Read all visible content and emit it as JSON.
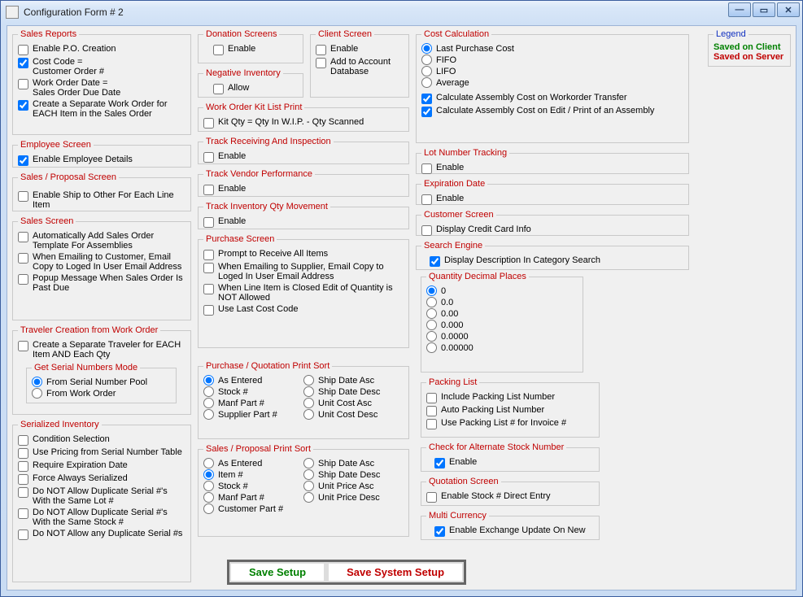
{
  "window": {
    "title": "Configuration Form # 2"
  },
  "legend": {
    "title": "Legend",
    "client": "Saved on Client",
    "server": "Saved on Server"
  },
  "salesReports": {
    "title": "Sales Reports",
    "enablePO": "Enable P.O.  Creation",
    "costCode": "Cost Code =\nCustomer Order #",
    "woDate": "Work Order Date =\nSales Order Due Date",
    "sepWO": "Create a Separate Work  Order for EACH  Item in the Sales Order"
  },
  "employee": {
    "title": "Employee Screen",
    "enable": "Enable Employee Details"
  },
  "salesProposal": {
    "title": "Sales  / Proposal Screen",
    "shipOther": "Enable Ship to Other For Each Line Item"
  },
  "salesScreen": {
    "title": "Sales Screen",
    "autoAdd": "Automatically Add Sales Order Template For Assemblies",
    "emailCopy": "When Emailing to Customer, Email Copy to Loged In User Email Address",
    "popup": "Popup Message When Sales Order Is Past Due"
  },
  "traveler": {
    "title": "Traveler Creation from Work Order",
    "sepTrav": "Create a Separate Traveler for EACH  Item AND Each Qty",
    "serialMode": {
      "title": "Get Serial Numbers Mode",
      "pool": "From Serial Number Pool",
      "wo": "From Work Order"
    }
  },
  "serialized": {
    "title": "Serialized Inventory",
    "cond": "Condition Selection",
    "pricing": "Use Pricing from Serial Number Table",
    "reqExp": "Require Expiration Date",
    "force": "Force Always Serialized",
    "dupLot": "Do NOT Allow Duplicate Serial #'s With the Same Lot #",
    "dupStock": "Do NOT Allow Duplicate Serial #'s With the Same Stock #",
    "dupAny": "Do NOT Allow any Duplicate Serial #s"
  },
  "donation": {
    "title": "Donation Screens",
    "enable": "Enable"
  },
  "negInv": {
    "title": "Negative Inventory",
    "allow": "Allow"
  },
  "clientScreen": {
    "title": "Client Screen",
    "enable": "Enable",
    "addDb": "Add to Account Database"
  },
  "woKit": {
    "title": "Work Order Kit List Print",
    "opt": "Kit Qty = Qty In W.I.P. - Qty Scanned"
  },
  "trackRecv": {
    "title": "Track Receiving And Inspection",
    "enable": "Enable"
  },
  "trackVendor": {
    "title": "Track Vendor Performance",
    "enable": "Enable"
  },
  "trackInvQty": {
    "title": "Track Inventory Qty Movement",
    "enable": "Enable"
  },
  "purchase": {
    "title": "Purchase Screen",
    "prompt": "Prompt to Receive All Items",
    "emailCopy": "When Emailing to Supplier, Email Copy to Loged In User Email Address",
    "closed": "When Line Item is Closed Edit of Quantity is NOT Allowed",
    "lastCost": "Use Last Cost Code"
  },
  "purchaseSort": {
    "title": "Purchase / Quotation Print Sort",
    "asEntered": "As Entered",
    "stock": "Stock #",
    "manf": "Manf Part #",
    "supplier": "Supplier Part #",
    "shipAsc": "Ship Date Asc",
    "shipDesc": "Ship Date Desc",
    "unitAsc": "Unit Cost Asc",
    "unitDesc": "Unit Cost Desc"
  },
  "salesSort": {
    "title": "Sales / Proposal Print Sort",
    "asEntered": "As Entered",
    "item": "Item #",
    "stock": "Stock #",
    "manf": "Manf Part #",
    "cust": "Customer Part #",
    "shipAsc": "Ship Date Asc",
    "shipDesc": "Ship Date Desc",
    "unitAsc": "Unit Price Asc",
    "unitDesc": "Unit Price Desc"
  },
  "costCalc": {
    "title": "Cost Calculation",
    "last": "Last Purchase Cost",
    "fifo": "FIFO",
    "lifo": "LIFO",
    "avg": "Average",
    "asmTransfer": "Calculate Assembly Cost on Workorder Transfer",
    "asmEdit": "Calculate Assembly Cost on Edit / Print of an Assembly"
  },
  "lotTrack": {
    "title": "Lot Number Tracking",
    "enable": "Enable"
  },
  "expDate": {
    "title": "Expiration Date",
    "enable": "Enable"
  },
  "custScreen": {
    "title": "Customer Screen",
    "cc": "Display Credit Card Info"
  },
  "search": {
    "title": "Search Engine",
    "desc": "Display Description In Category Search"
  },
  "qtyDec": {
    "title": "Quantity Decimal Places",
    "o0": "0",
    "o1": "0.0",
    "o2": "0.00",
    "o3": "0.000",
    "o4": "0.0000",
    "o5": "0.00000"
  },
  "packing": {
    "title": "Packing List",
    "incl": "Include Packing List Number",
    "auto": "Auto Packing List Number",
    "inv": "Use Packing List # for Invoice #"
  },
  "altStock": {
    "title": "Check for Alternate Stock Number",
    "enable": "Enable"
  },
  "quotation": {
    "title": "Quotation Screen",
    "direct": "Enable Stock # Direct Entry"
  },
  "multiCur": {
    "title": "Multi Currency",
    "enable": "Enable Exchange Update On New"
  },
  "buttons": {
    "save": "Save Setup",
    "saveSys": "Save System Setup"
  }
}
